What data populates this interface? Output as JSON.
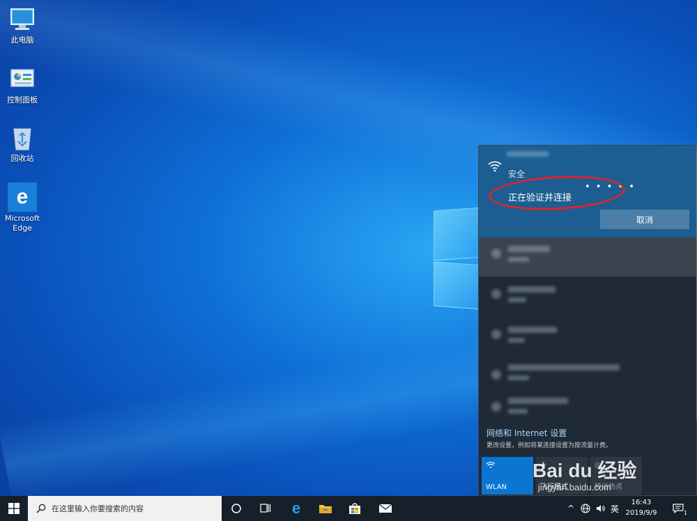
{
  "desktop": {
    "icons": [
      {
        "label": "此电脑",
        "icon": "this-pc-icon"
      },
      {
        "label": "控制面板",
        "icon": "control-panel-icon"
      },
      {
        "label": "回收站",
        "icon": "recycle-bin-icon"
      },
      {
        "label": "Microsoft Edge",
        "icon": "edge-icon"
      }
    ]
  },
  "network_flyout": {
    "connecting": {
      "security": "安全",
      "status": "正在验证并连接",
      "progress_dots": "• • • • •",
      "cancel_label": "取消"
    },
    "settings": {
      "title": "网络和 Internet 设置",
      "description": "更改设置，例如将某连接设置为按流量计费。"
    },
    "quick_actions": [
      {
        "label": "WLAN",
        "icon": "wifi-icon",
        "active": true
      },
      {
        "label": "飞行模式",
        "icon": "airplane-icon",
        "active": false
      },
      {
        "label": "移动热点",
        "icon": "hotspot-icon",
        "active": false
      }
    ]
  },
  "taskbar": {
    "search_placeholder": "在这里输入你要搜索的内容",
    "pinned": [
      "cortana-icon",
      "task-view-icon",
      "edge-icon",
      "file-explorer-icon",
      "store-icon",
      "mail-icon"
    ],
    "tray": {
      "ime": "英",
      "time": "16:43",
      "date": "2019/9/9",
      "notification_count": "1"
    }
  },
  "watermark": {
    "brand": "Bai du 经验",
    "site": "jingyan.baidu.com"
  },
  "colors": {
    "flyout_bg": "#1f2a36",
    "connecting_bg": "#1c5e92",
    "accent": "#0b76d2",
    "highlight_oval": "#e2232a"
  }
}
